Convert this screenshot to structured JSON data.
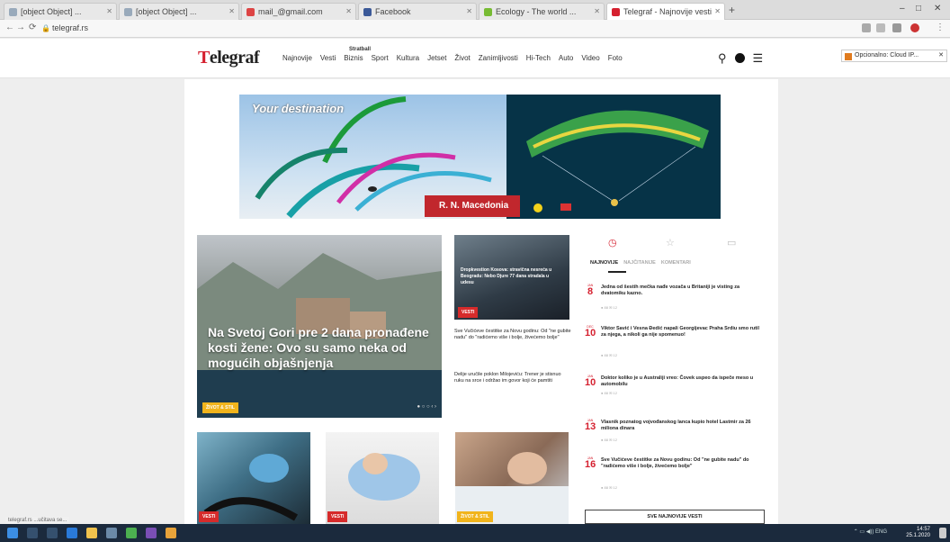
{
  "browser": {
    "tabs": [
      {
        "label": "[object Object] ...",
        "active": false
      },
      {
        "label": "[object Object] ...",
        "active": false
      },
      {
        "label": "mail_@gmail.com",
        "active": false
      },
      {
        "label": "Facebook",
        "active": false
      },
      {
        "label": "Ecology - The world ...",
        "active": false
      },
      {
        "label": "Telegraf - Najnovije vesti",
        "active": true
      }
    ],
    "url": "telegraf.rs",
    "status_text": "telegraf.rs ...učitava se..."
  },
  "site": {
    "logo_first": "T",
    "logo_rest": "elegraf",
    "nav_sub": "Stratball",
    "nav": [
      "Najnovije",
      "Vesti",
      "Biznis",
      "Sport",
      "Kultura",
      "Jetset",
      "Život",
      "Zanimljivosti",
      "Hi-Tech",
      "Auto",
      "Video",
      "Foto"
    ],
    "right_ad_label": "Opcionalno: Cloud IP..."
  },
  "banner": {
    "title": "Your destination",
    "brand": "R. N. Macedonia"
  },
  "featured": {
    "title": "Na Svetoj Gori pre 2 dana pronađene kosti žene: Ovo su samo neka od mogućih objašnjenja",
    "tag": "ŽIVOT & STIL",
    "dots": "● ○ ○ ‹ ›"
  },
  "mid": {
    "img_caption": "Dropkvestion Kosova: stravična nesreća u Beogradu: Nebo Djure 77 dana stradala u udesu",
    "img_tag": "VESTI",
    "story1": "Sve Vučićeve čestitke za Novu godinu: Od \"ne gubite nadu\" do \"radićemo više i bolje, živećemo bolje\"",
    "story2": "Delije uručile poklon Milojeviću: Trener je stisnuo ruku na srce i održao im govor koji će pamtiti"
  },
  "sidebar": {
    "tabs": [
      "NAJNOVIJE",
      "NAJČITANIJE",
      "KOMENTARI"
    ],
    "items": [
      {
        "month": "JAN",
        "day": "8",
        "text": "Jedna od šestih mečka nađe vozača u Britaniji je visting za dvatomiku kazno.",
        "meta": "● 88  ✉ 12"
      },
      {
        "month": "DEC",
        "day": "10",
        "text": "Viktor Savić i Vesna Đedić napali Georgijevac Praha Srdiu smo rutil za njega, a nikoli ga nije spomenuo!",
        "meta": "● 88  ✉ 12"
      },
      {
        "month": "JAN",
        "day": "10",
        "text": "Doktor koliko je u Australiji vreo: Čovek uspeo da ispeče meso u automobilu",
        "meta": "● 88  ✉ 12"
      },
      {
        "month": "JAN",
        "day": "13",
        "text": "Vlasnik poznatog vojvođanskog lanca kupio hotel Lastmir za 26 miliona dinara",
        "meta": "● 88  ✉ 12"
      },
      {
        "month": "JAN",
        "day": "16",
        "text": "Sve Vučićeve čestitke za Novu godinu: Od \"ne gubite nadu\" do \"radićemo više i bolje, živećemo bolje\"",
        "meta": "● 88  ✉ 12"
      }
    ],
    "all_news": "SVE NAJNOVIJE VESTI"
  },
  "bottom": {
    "tags": [
      "VESTI",
      "VESTI",
      "ŽIVOT & STIL"
    ]
  },
  "taskbar": {
    "time": "14:57",
    "date": "25.1.2020"
  }
}
